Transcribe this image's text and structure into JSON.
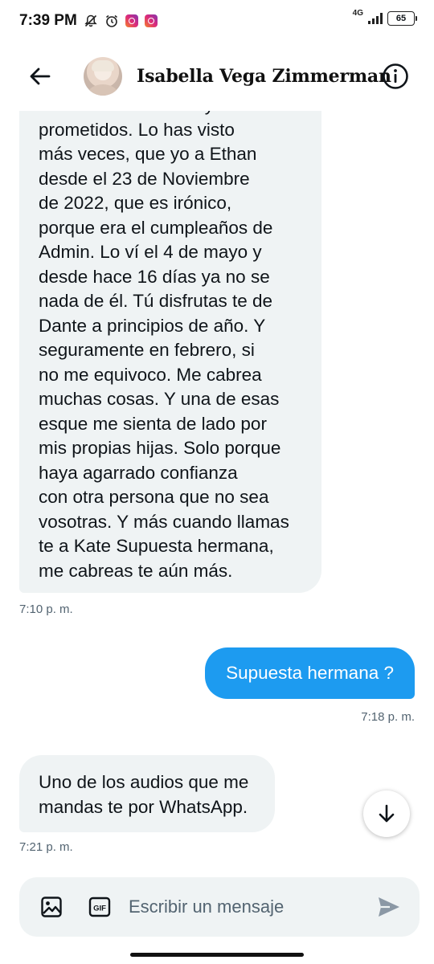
{
  "status_bar": {
    "time": "7:39 PM",
    "network": "4G",
    "battery": "65",
    "icons": [
      "mute-icon",
      "alarm-icon",
      "instagram-icon",
      "instagram-icon"
    ]
  },
  "header": {
    "back_icon": "arrow-left-icon",
    "contact_name": "Isabella Vega Zimmerman",
    "info_icon": "info-circle-icon"
  },
  "messages": [
    {
      "direction": "incoming",
      "lines": [
        "motivos. Y volvieron y anda",
        "prometidos. Lo has visto",
        "más veces, que yo a Ethan",
        "desde el 23 de Noviembre",
        "de 2022, que es irónico,",
        "porque era el cumpleaños de",
        "Admin. Lo ví el 4 de mayo y",
        "desde hace 16 días ya no se",
        "nada de él. Tú disfrutas te de",
        "Dante a principios de año. Y",
        "seguramente en febrero, si",
        "no me equivoco. Me cabrea",
        "muchas cosas. Y una de esas",
        "esque me sienta de lado por",
        "mis propias hijas. Solo porque",
        "haya agarrado confianza",
        "con otra persona que no sea",
        "vosotras. Y más cuando llamas",
        "te a Kate Supuesta hermana,",
        "me cabreas te aún más."
      ],
      "time": "7:10 p. m."
    },
    {
      "direction": "outgoing",
      "text": "Supuesta hermana ?",
      "time": "7:18 p. m."
    },
    {
      "direction": "incoming",
      "lines": [
        "Uno de los audios que me",
        "mandas te por WhatsApp."
      ],
      "time": "7:21 p. m."
    }
  ],
  "composer": {
    "placeholder": "Escribir un mensaje",
    "gif_label": "GIF"
  },
  "colors": {
    "incoming_bubble": "#eff3f4",
    "outgoing_bubble": "#1d9bf0",
    "timestamp": "#536471"
  }
}
